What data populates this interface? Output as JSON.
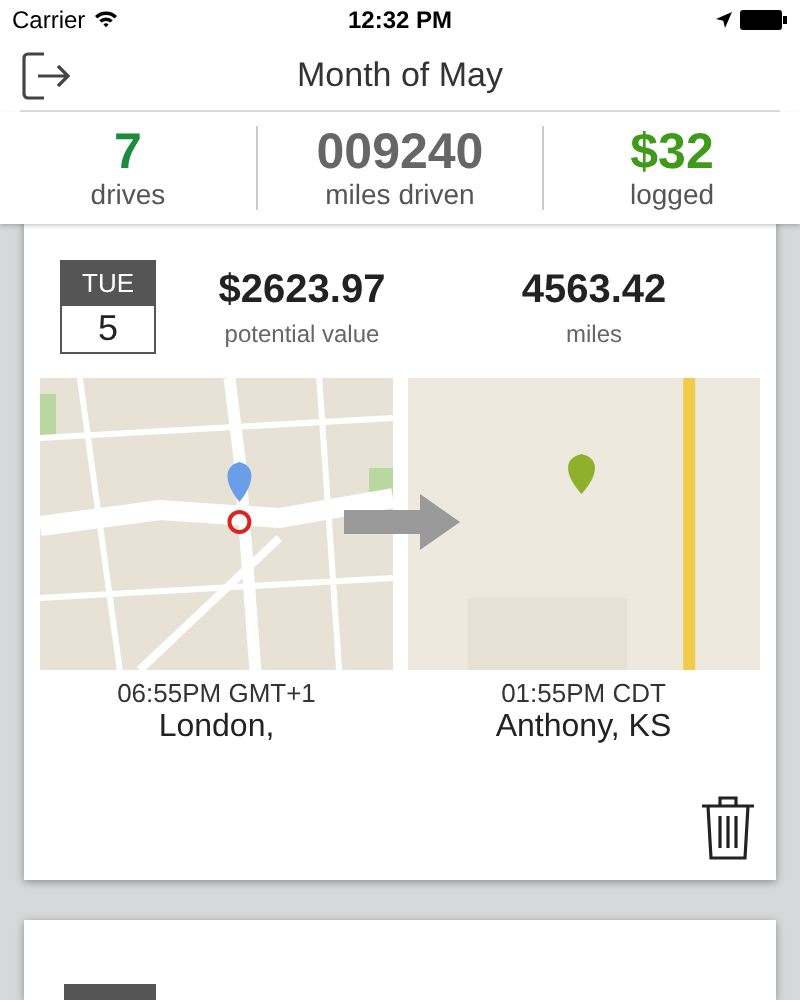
{
  "status_bar": {
    "carrier": "Carrier",
    "time": "12:32 PM"
  },
  "header": {
    "title": "Month of May"
  },
  "stats": [
    {
      "value": "7",
      "label": "drives",
      "color": "#1e8a3c"
    },
    {
      "value": "009240",
      "label": "miles driven",
      "color": "#666666"
    },
    {
      "value": "$32",
      "label": "logged",
      "color": "#3f9a1a"
    }
  ],
  "drives": [
    {
      "weekday": "TUE",
      "day": "5",
      "value": "$2623.97",
      "value_label": "potential value",
      "miles": "4563.42",
      "miles_label": "miles",
      "start": {
        "time": "06:55PM GMT+1",
        "place": "London,"
      },
      "end": {
        "time": "01:55PM CDT",
        "place": "Anthony, KS"
      }
    }
  ],
  "next_card": {
    "kind": "partial"
  }
}
